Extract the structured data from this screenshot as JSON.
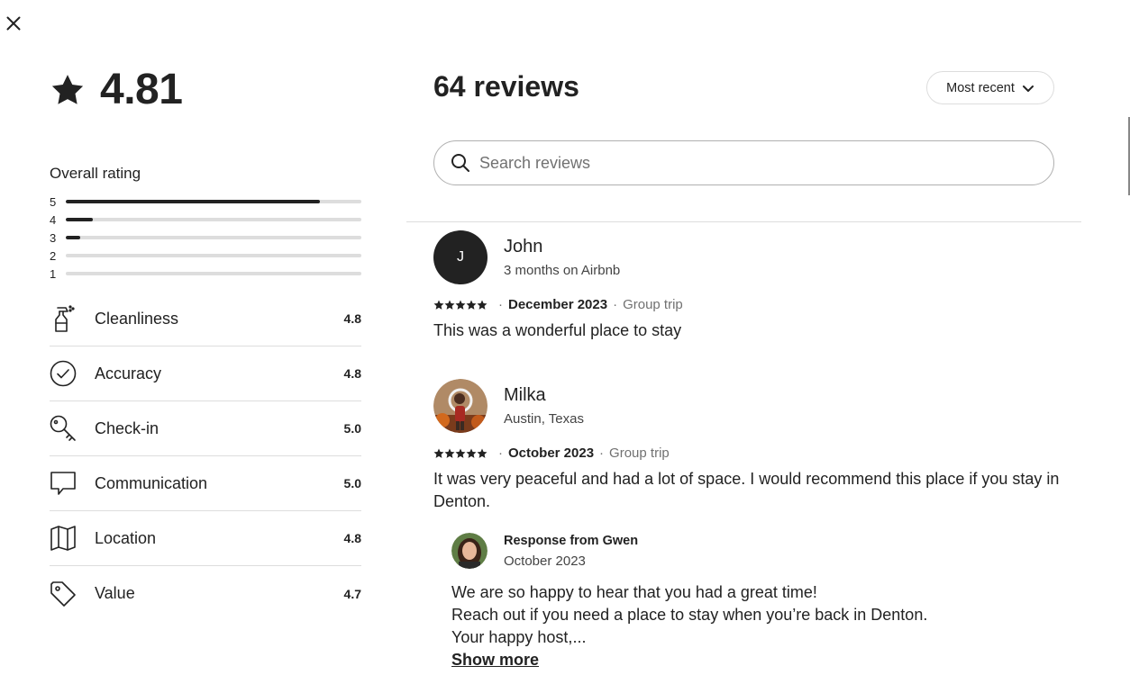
{
  "close": {
    "icon": "close-icon"
  },
  "summary": {
    "score": "4.81",
    "overall_label": "Overall rating",
    "distribution": [
      {
        "stars": "5",
        "fraction": 0.86
      },
      {
        "stars": "4",
        "fraction": 0.09
      },
      {
        "stars": "3",
        "fraction": 0.05
      },
      {
        "stars": "2",
        "fraction": 0.0
      },
      {
        "stars": "1",
        "fraction": 0.0
      }
    ],
    "categories": [
      {
        "label": "Cleanliness",
        "value": "4.8",
        "icon": "spray-bottle-icon"
      },
      {
        "label": "Accuracy",
        "value": "4.8",
        "icon": "check-circle-icon"
      },
      {
        "label": "Check-in",
        "value": "5.0",
        "icon": "key-icon"
      },
      {
        "label": "Communication",
        "value": "5.0",
        "icon": "chat-bubble-icon"
      },
      {
        "label": "Location",
        "value": "4.8",
        "icon": "map-icon"
      },
      {
        "label": "Value",
        "value": "4.7",
        "icon": "price-tag-icon"
      }
    ]
  },
  "header": {
    "title": "64 reviews",
    "sort_label": "Most recent"
  },
  "search": {
    "placeholder": "Search reviews"
  },
  "reviews": [
    {
      "name": "John",
      "avatar_letter": "J",
      "subtitle": "3 months on Airbnb",
      "rating": 5,
      "date": "December 2023",
      "trip": "Group trip",
      "text": "This was a wonderful place to stay"
    },
    {
      "name": "Milka",
      "subtitle": "Austin, Texas",
      "rating": 5,
      "date": "October 2023",
      "trip": "Group trip",
      "text": "It was very peaceful and had a lot of space. I would recommend this place if you stay in Denton.",
      "response": {
        "title": "Response from Gwen",
        "date": "October 2023",
        "lines": [
          "We are so happy to hear that you had a great time!",
          "Reach out if you need a place to stay when you’re back in Denton.",
          "Your happy host,..."
        ],
        "show_more": "Show more"
      }
    }
  ],
  "meta_separator": "·"
}
